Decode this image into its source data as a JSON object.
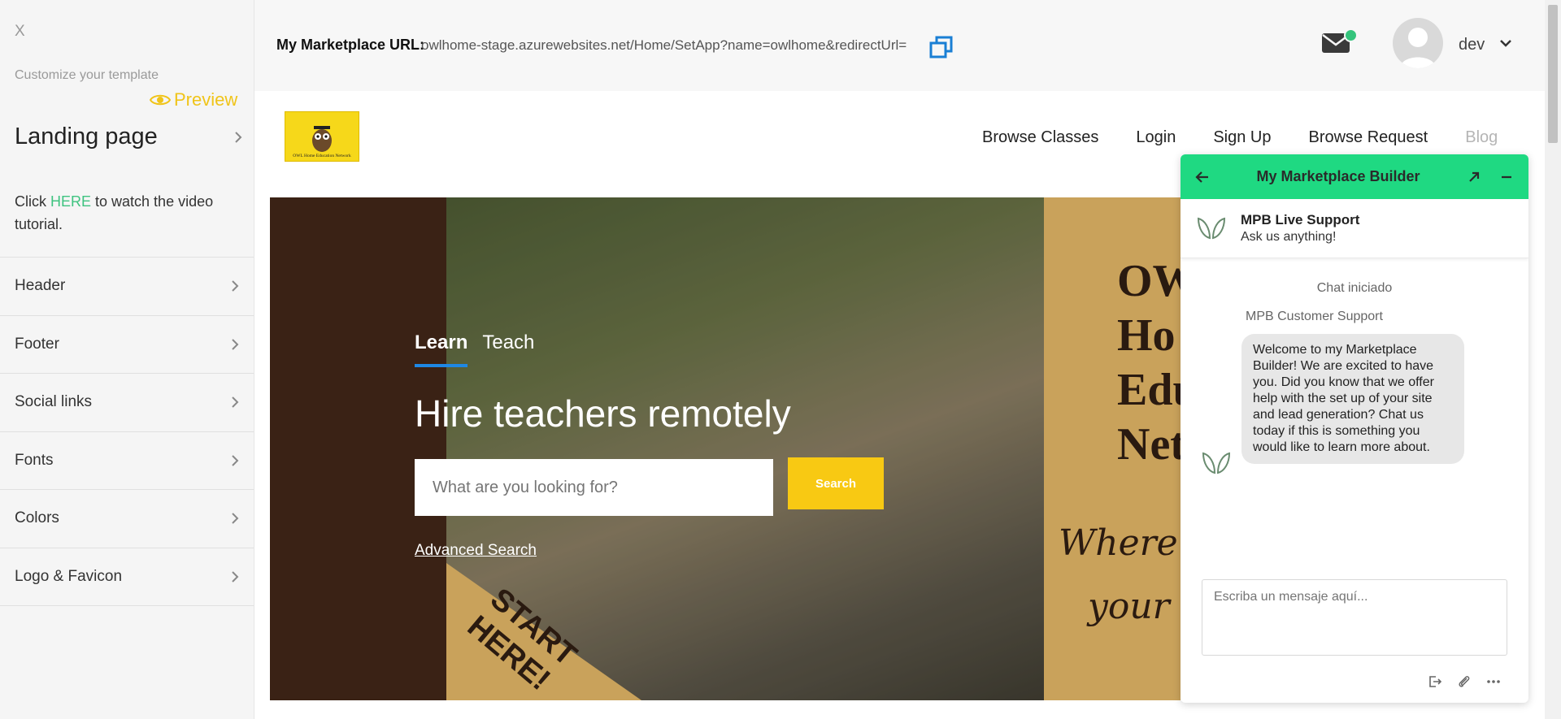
{
  "sidebar": {
    "close_label": "X",
    "subtitle": "Customize your template",
    "preview_label": "Preview",
    "landing_label": "Landing page",
    "tutorial_prefix": "Click ",
    "tutorial_link": "HERE",
    "tutorial_suffix": " to watch the video tutorial.",
    "items": [
      {
        "label": "Header"
      },
      {
        "label": "Footer"
      },
      {
        "label": "Social links"
      },
      {
        "label": "Fonts"
      },
      {
        "label": "Colors"
      },
      {
        "label": "Logo & Favicon"
      }
    ]
  },
  "topbar": {
    "url_label": "My Marketplace URL:",
    "url_value": "owlhome-stage.azurewebsites.net/Home/SetApp?name=owlhome&redirectUrl=",
    "user_name": "dev"
  },
  "site": {
    "logo_text": "OWL Home Education Network",
    "nav": [
      "Browse Classes",
      "Login",
      "Sign Up",
      "Browse Request",
      "Blog"
    ]
  },
  "hero": {
    "tabs": [
      "Learn",
      "Teach"
    ],
    "title": "Hire teachers remotely",
    "search_placeholder": "What are you looking for?",
    "search_button": "Search",
    "advanced_search": "Advanced Search",
    "owl_text": [
      "OW",
      "Ho",
      "Edu",
      "Net"
    ],
    "script_text": [
      "Where th",
      "your cl"
    ],
    "corner_text": [
      "START",
      "HERE!"
    ]
  },
  "chat": {
    "title": "My Marketplace Builder",
    "agent_name": "MPB Live Support",
    "agent_sub": "Ask us anything!",
    "started": "Chat iniciado",
    "sender": "MPB Customer Support",
    "message": "Welcome to my Marketplace Builder! We are excited to have you. Did you know that we offer help with the set up of your site and lead generation? Chat us today if this is something you would like to learn more about.",
    "input_placeholder": "Escriba un mensaje aquí..."
  },
  "colors": {
    "accent_green": "#1fd982",
    "preview_yellow": "#f0c419",
    "search_yellow": "#f8c913",
    "tab_blue": "#1e88e5",
    "copy_blue": "#1a7fd4"
  }
}
